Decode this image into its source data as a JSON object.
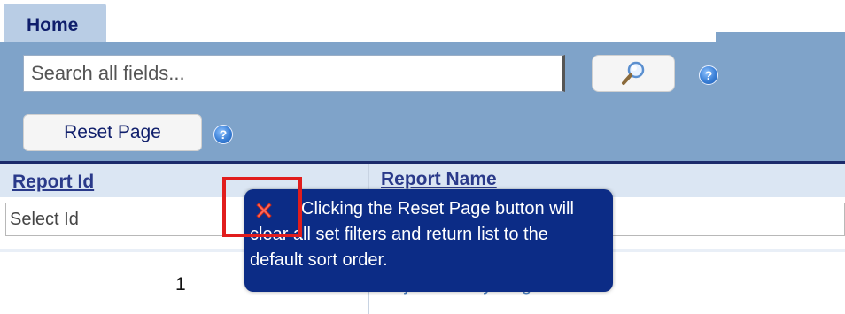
{
  "tabs": [
    {
      "label": "Home"
    }
  ],
  "search": {
    "placeholder": "Search all fields...",
    "value": ""
  },
  "icons": {
    "search_button": "magnifier-icon",
    "help": "question-mark-icon",
    "tooltip_close": "close-x-icon"
  },
  "toolbar": {
    "reset_label": "Reset Page",
    "help_glyph": "?"
  },
  "table": {
    "columns": [
      {
        "label": "Report Id"
      },
      {
        "label": "Report Name"
      }
    ],
    "filters": {
      "id_placeholder": "Select Id"
    },
    "rows": [
      {
        "id": "1",
        "name": "Projections by Region"
      }
    ]
  },
  "tooltip": {
    "text": "Clicking the Reset Page button will clear all set filters and return list to the default sort order."
  },
  "colors": {
    "panel": "#7fa3c9",
    "tooltip": "#0c2c86",
    "highlight": "#e11d1d",
    "header_text": "#2a3a8a",
    "link": "#4a7fc0"
  }
}
